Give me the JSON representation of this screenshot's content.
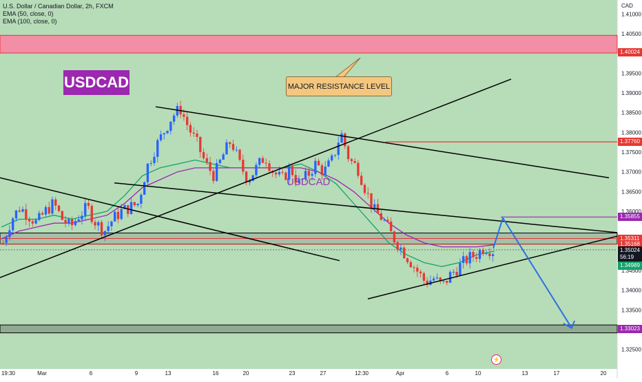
{
  "legend": {
    "symbol_line": "U.S. Dollar / Canadian Dollar, 2h, FXCM",
    "ema50": "EMA (50, close, 0)",
    "ema100": "EMA (100, close, 0)"
  },
  "currency": "CAD",
  "symbol_badge": "USDCAD",
  "watermark": "USDCAD",
  "callout": "MAJOR RESISTANCE LEVEL",
  "colors": {
    "background_green": "#b7dcb8",
    "resistance_zone": "#f28ea5",
    "resistance_line": "#e53935",
    "up_candle": "#2962ff",
    "down_candle": "#e53935",
    "ema50": "#13a36b",
    "ema100": "#9c27b0",
    "trendline": "#000000",
    "arrow": "#2f6fe0",
    "badge": "#9c27b0",
    "callout_bg": "#f5c77e"
  },
  "chart_data": {
    "type": "line",
    "title": "U.S. Dollar / Canadian Dollar, 2h, FXCM",
    "ylabel": "CAD",
    "ylim": [
      1.3225,
      1.4125
    ],
    "y_ticks": [
      1.41,
      1.405,
      1.395,
      1.39,
      1.385,
      1.38,
      1.375,
      1.37,
      1.365,
      1.36,
      1.345,
      1.34,
      1.335,
      1.325
    ],
    "x_tick_labels": [
      "19:30",
      "Mar",
      "6",
      "9",
      "13",
      "16",
      "20",
      "23",
      "27",
      "12:30",
      "Apr",
      "6",
      "10",
      "13",
      "17",
      "20"
    ],
    "price_labels": [
      {
        "value": 1.40024,
        "label": "1.40024",
        "color": "#e53935"
      },
      {
        "value": 1.3776,
        "label": "1.37760",
        "color": "#e53935"
      },
      {
        "value": 1.35855,
        "label": "1.35855",
        "color": "#9c27b0"
      },
      {
        "value": 1.35311,
        "label": "1.35311",
        "color": "#e53935"
      },
      {
        "value": 1.35168,
        "label": "1.35168",
        "color": "#e53935"
      },
      {
        "value": 1.35024,
        "label": "1.35024",
        "color": "#131722"
      },
      {
        "value": 1.34989,
        "label": "1.34989",
        "color": "#13a36b"
      },
      {
        "value": 1.33023,
        "label": "1.33023",
        "color": "#9c27b0"
      }
    ],
    "countdown": "56:19",
    "series": [
      {
        "name": "USDCAD",
        "type": "price",
        "values": [
          1.352,
          1.358,
          1.361,
          1.359,
          1.357,
          1.36,
          1.362,
          1.358,
          1.356,
          1.359,
          1.361,
          1.357,
          1.355,
          1.358,
          1.36,
          1.361,
          1.362,
          1.371,
          1.376,
          1.38,
          1.384,
          1.386,
          1.381,
          1.377,
          1.372,
          1.369,
          1.374,
          1.378,
          1.372,
          1.368,
          1.371,
          1.374,
          1.37,
          1.368,
          1.371,
          1.367,
          1.369,
          1.372,
          1.37,
          1.373,
          1.38,
          1.373,
          1.371,
          1.365,
          1.36,
          1.358,
          1.354,
          1.351,
          1.348,
          1.345,
          1.342,
          1.343,
          1.341,
          1.344,
          1.346,
          1.348,
          1.349,
          1.351,
          1.35
        ]
      },
      {
        "name": "EMA (50, close, 0)",
        "values": [
          1.356,
          1.358,
          1.358,
          1.359,
          1.358,
          1.359,
          1.36,
          1.364,
          1.369,
          1.371,
          1.372,
          1.373,
          1.372,
          1.371,
          1.371,
          1.371,
          1.371,
          1.372,
          1.37,
          1.367,
          1.362,
          1.357,
          1.352,
          1.349,
          1.347,
          1.346,
          1.347,
          1.349,
          1.3499
        ]
      },
      {
        "name": "EMA (100, close, 0)",
        "values": [
          1.353,
          1.355,
          1.356,
          1.357,
          1.357,
          1.358,
          1.359,
          1.362,
          1.366,
          1.368,
          1.37,
          1.371,
          1.371,
          1.371,
          1.371,
          1.371,
          1.371,
          1.371,
          1.37,
          1.368,
          1.365,
          1.361,
          1.357,
          1.354,
          1.352,
          1.351,
          1.351,
          1.351,
          1.3515
        ]
      }
    ],
    "annotations": [
      "MAJOR RESISTANCE LEVEL"
    ],
    "grid": false,
    "legend_position": "top-left"
  }
}
